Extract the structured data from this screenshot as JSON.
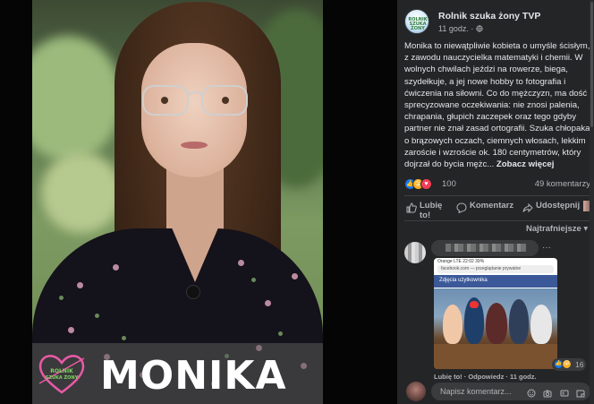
{
  "photo": {
    "caption_name": "MONIKA",
    "logo_text": "Rolnik szuka żony"
  },
  "post": {
    "page_name": "Rolnik szuka żony TVP",
    "time": "11 godz. · ",
    "avatar_text": "ROLNIK SZUKA ŻONY",
    "text": "Monika to niewątpliwie kobieta o umyśle ścisłym, z zawodu nauczycielka matematyki i chemii. W wolnych chwilach jeździ na rowerze, biega, szydełkuje, a jej nowe hobby to fotografia i ćwiczenia na siłowni. Co do mężczyzn, ma dość sprecyzowane oczekiwania: nie znosi palenia, chrapania, głupich zaczepek oraz tego gdyby partner nie znał zasad ortografii. Szuka chłopaka o brązowych oczach, ciemnych włosach, lekkim zaroście i wzroście ok. 180 centymetrów, który dojrzał do bycia mężc...",
    "see_more": "Zobacz więcej"
  },
  "reactions": {
    "count": "100",
    "comments": "49 komentarzy",
    "icons": [
      "like-icon",
      "wow-icon",
      "love-icon"
    ]
  },
  "actions": {
    "like": "Lubię to!",
    "comment": "Komentarz",
    "share": "Udostępnij"
  },
  "sort_label": "Najtrafniejsze",
  "comment": {
    "more": "···",
    "screenshot": {
      "status": "Orange LTE   22:02   39%",
      "url": "facebook.com — przeglądanie prywatne",
      "bar": "Zdjęcia użytkownika"
    },
    "reaction_count": "16",
    "links": "Lubię to! · Odpowiedz · 11 godz."
  },
  "composer": {
    "placeholder": "Napisz komentarz..."
  },
  "colors": {
    "panel": "#242526",
    "bubble": "#3a3b3c",
    "like": "#1877f2",
    "love": "#f33e58",
    "wow": "#f7b125"
  }
}
